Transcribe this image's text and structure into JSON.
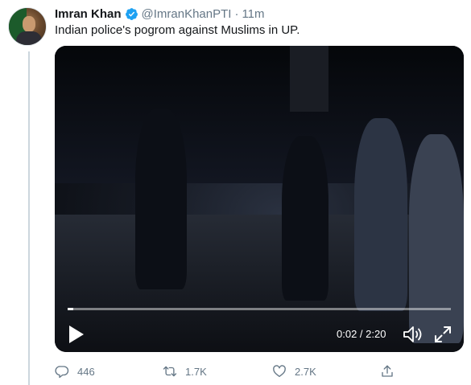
{
  "tweet": {
    "author_name": "Imran Khan",
    "handle": "@ImranKhanPTI",
    "separator": "·",
    "time": "11m",
    "text": "Indian police's pogrom against Muslims in UP."
  },
  "video": {
    "timecode": "0:02 / 2:20",
    "progress_fraction": 0.014,
    "icons": {
      "play": "play-icon",
      "volume": "volume-icon",
      "fullscreen": "fullscreen-icon"
    }
  },
  "actions": {
    "reply_count": "446",
    "retweet_count": "1.7K",
    "like_count": "2.7K"
  },
  "colors": {
    "verified_badge": "#1da1f2",
    "meta_text": "#657786",
    "thread_line": "#ccd6dd"
  }
}
